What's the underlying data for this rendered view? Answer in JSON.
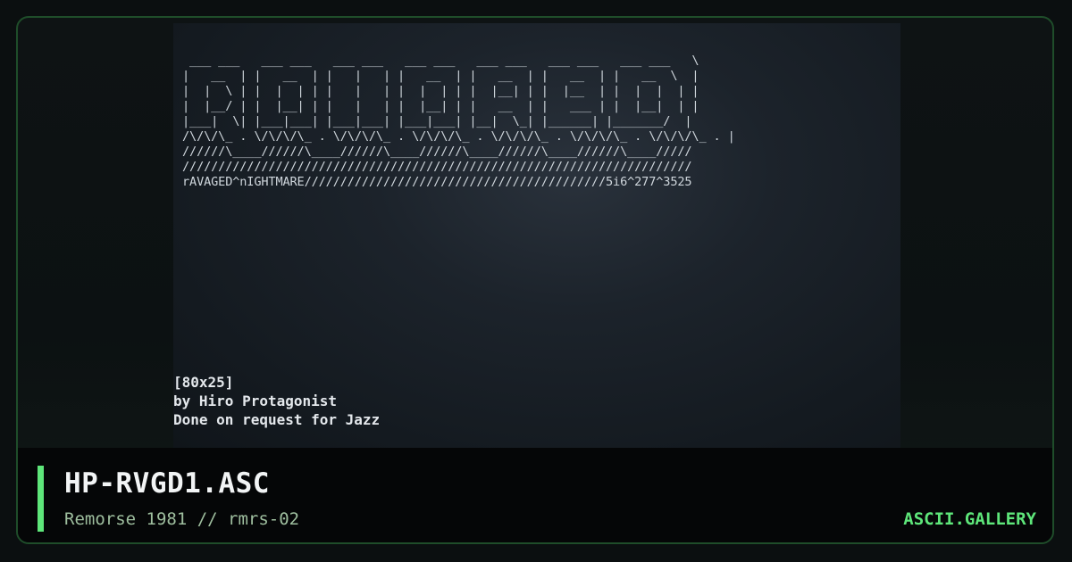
{
  "artwork": {
    "ascii_lines": [
      " ___ ___   ___ ___   ___ ___   ___ ___   ___ ___   ___ ___   ___ ___   \\",
      "|   __  | |   __  | |   |   | |   __  | |   __  | |   __  | |   __  \\  |",
      "|  |  \\ | |  |  | | |   |   | |  |  | | |  |__| | |  |__  | |  |  |  | |",
      "|  |__/ | |  |__| | |   |   | |  |__| | |   __  | |   ___ | |  |__|  | |",
      "|___|  \\| |___|___| |___|___| |___|___| |__|  \\_| |______| |_______/  |",
      "/\\/\\/\\_ . \\/\\/\\/\\_ . \\/\\/\\/\\_ . \\/\\/\\/\\_ . \\/\\/\\/\\_ . \\/\\/\\/\\_ . \\/\\/\\/\\_ . |",
      "//////\\____//////\\____//////\\____//////\\____//////\\____//////\\____/////",
      "///////////////////////////////////////////////////////////////////////",
      "rAVAGED^nIGHTMARE//////////////////////////////////////////5i6^277^3525"
    ],
    "size_tag": "[80x25]",
    "author_line": "by Hiro Protagonist",
    "request_line": "Done on request for Jazz"
  },
  "footer": {
    "title": "HP-RVGD1.ASC",
    "subtitle": "Remorse 1981 // rmrs-02",
    "brand": "ASCII.GALLERY"
  },
  "colors": {
    "accent": "#5ee67a",
    "border": "#1f4d2a",
    "text": "#f2f4f5",
    "subtitle": "#9fbf9f"
  }
}
